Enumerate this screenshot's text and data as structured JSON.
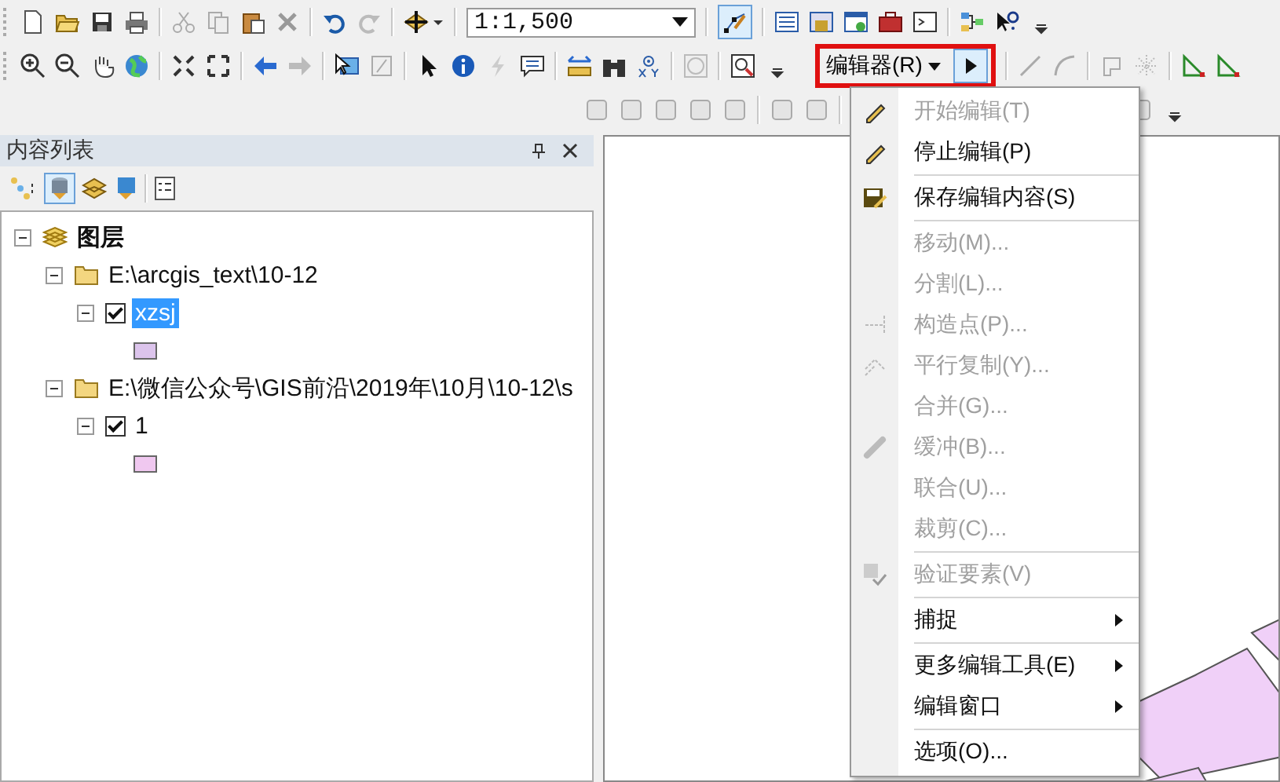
{
  "toolbar": {
    "scale": "1:1,500",
    "editor_toolbar_toggle": {
      "selected": true
    }
  },
  "editor_toolbar": {
    "menu_label": "编辑器(R)",
    "edit_tool": {
      "selected": true
    }
  },
  "contents_panel": {
    "title": "内容列表",
    "tree": [
      {
        "label": "图层",
        "expanded": true,
        "children": [
          {
            "label": "E:\\arcgis_text\\10-12",
            "expanded": true,
            "children": [
              {
                "label": "xzsj",
                "expanded": true,
                "checked": true,
                "selected": true,
                "color": "#dcc4ec"
              }
            ]
          },
          {
            "label": "E:\\微信公众号\\GIS前沿\\2019年\\10月\\10-12\\s",
            "expanded": true,
            "children": [
              {
                "label": "1",
                "expanded": true,
                "checked": true,
                "selected": false,
                "color": "#f0c8f0"
              }
            ]
          }
        ]
      }
    ]
  },
  "editor_menu": {
    "items": [
      {
        "label": "开始编辑(T)",
        "kind": "item",
        "disabled": true,
        "separator_before": false
      },
      {
        "label": "停止编辑(P)",
        "kind": "item",
        "disabled": false,
        "separator_before": false
      },
      {
        "label": "保存编辑内容(S)",
        "kind": "item",
        "disabled": false,
        "separator_before": true
      },
      {
        "label": "移动(M)...",
        "kind": "item",
        "disabled": true,
        "separator_before": true
      },
      {
        "label": "分割(L)...",
        "kind": "item",
        "disabled": true,
        "separator_before": false
      },
      {
        "label": "构造点(P)...",
        "kind": "item",
        "disabled": true,
        "separator_before": false
      },
      {
        "label": "平行复制(Y)...",
        "kind": "item",
        "disabled": true,
        "separator_before": false
      },
      {
        "label": "合并(G)...",
        "kind": "item",
        "disabled": true,
        "separator_before": false
      },
      {
        "label": "缓冲(B)...",
        "kind": "item",
        "disabled": true,
        "separator_before": false
      },
      {
        "label": "联合(U)...",
        "kind": "item",
        "disabled": true,
        "separator_before": false
      },
      {
        "label": "裁剪(C)...",
        "kind": "item",
        "disabled": true,
        "separator_before": false
      },
      {
        "label": "验证要素(V)",
        "kind": "item",
        "disabled": true,
        "separator_before": true
      },
      {
        "label": "捕捉",
        "kind": "submenu",
        "disabled": false,
        "separator_before": true
      },
      {
        "label": "更多编辑工具(E)",
        "kind": "submenu",
        "disabled": false,
        "separator_before": true
      },
      {
        "label": "编辑窗口",
        "kind": "submenu",
        "disabled": false,
        "separator_before": false
      },
      {
        "label": "选项(O)...",
        "kind": "item",
        "disabled": false,
        "separator_before": true
      }
    ]
  }
}
